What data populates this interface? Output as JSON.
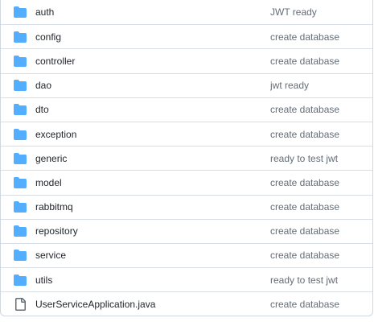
{
  "colors": {
    "folder_icon": "#54aeff",
    "file_icon": "#656d76",
    "commit_text": "#656d76",
    "name_text": "#1f2328"
  },
  "entries": [
    {
      "type": "folder",
      "icon": "folder-icon",
      "name": "auth",
      "commit": "JWT ready"
    },
    {
      "type": "folder",
      "icon": "folder-icon",
      "name": "config",
      "commit": "create database"
    },
    {
      "type": "folder",
      "icon": "folder-icon",
      "name": "controller",
      "commit": "create database"
    },
    {
      "type": "folder",
      "icon": "folder-icon",
      "name": "dao",
      "commit": "jwt ready"
    },
    {
      "type": "folder",
      "icon": "folder-icon",
      "name": "dto",
      "commit": "create database"
    },
    {
      "type": "folder",
      "icon": "folder-icon",
      "name": "exception",
      "commit": "create database"
    },
    {
      "type": "folder",
      "icon": "folder-icon",
      "name": "generic",
      "commit": "ready to test jwt"
    },
    {
      "type": "folder",
      "icon": "folder-icon",
      "name": "model",
      "commit": "create database"
    },
    {
      "type": "folder",
      "icon": "folder-icon",
      "name": "rabbitmq",
      "commit": "create database"
    },
    {
      "type": "folder",
      "icon": "folder-icon",
      "name": "repository",
      "commit": "create database"
    },
    {
      "type": "folder",
      "icon": "folder-icon",
      "name": "service",
      "commit": "create database"
    },
    {
      "type": "folder",
      "icon": "folder-icon",
      "name": "utils",
      "commit": "ready to test jwt"
    },
    {
      "type": "file",
      "icon": "file-icon",
      "name": "UserServiceApplication.java",
      "commit": "create database"
    }
  ]
}
